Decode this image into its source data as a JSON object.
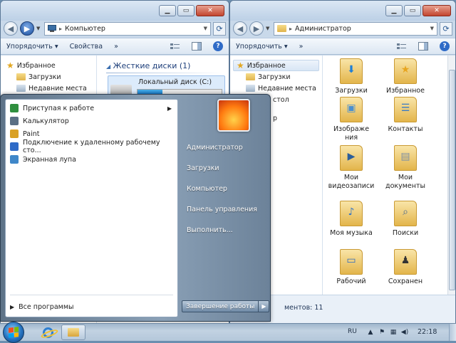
{
  "window1": {
    "address": "Компьютер",
    "toolbar": {
      "organize": "Упорядочить",
      "properties": "Свойства",
      "more": "»"
    },
    "nav": {
      "favorites": "Избранное",
      "downloads": "Загрузки",
      "recent": "Недавние места"
    },
    "group_title": "Жесткие диски (1)",
    "disk": {
      "name": "Локальный диск (C:)",
      "used_fraction": 0.3
    }
  },
  "window2": {
    "address": "Администратор",
    "toolbar": {
      "organize": "Упорядочить",
      "more": "»"
    },
    "nav": {
      "favorites": "Избранное",
      "downloads": "Загрузки",
      "recent": "Недавние места",
      "desktop_partial": "стол",
      "partial2": "р"
    },
    "items": [
      {
        "label": "Загрузки",
        "icon": "download-arrow"
      },
      {
        "label": "Избранное",
        "icon": "star"
      },
      {
        "label": "Изображе ния",
        "icon": "pictures"
      },
      {
        "label": "Контакты",
        "icon": "contacts"
      },
      {
        "label": "Мои видеозаписи",
        "icon": "video"
      },
      {
        "label": "Мои документы",
        "icon": "documents"
      },
      {
        "label": "Моя музыка",
        "icon": "music-note"
      },
      {
        "label": "Поиски",
        "icon": "magnifier"
      },
      {
        "label": "Рабочий",
        "icon": "desktop"
      },
      {
        "label": "Сохранен",
        "icon": "chess-piece"
      }
    ],
    "status": "ментов: 11"
  },
  "startmenu": {
    "programs": [
      {
        "label": "Приступая к работе",
        "has_submenu": true,
        "color": "#2f8f3e"
      },
      {
        "label": "Калькулятор",
        "has_submenu": false,
        "color": "#5b6f84"
      },
      {
        "label": "Paint",
        "has_submenu": false,
        "color": "#d9a125"
      },
      {
        "label": "Подключение к удаленному рабочему сто...",
        "has_submenu": false,
        "color": "#2f6bc7"
      },
      {
        "label": "Экранная лупа",
        "has_submenu": false,
        "color": "#3f87c9"
      }
    ],
    "all_programs": "Все программы",
    "right_links": [
      "Администратор",
      "Загрузки",
      "Компьютер",
      "Панель управления",
      "Выполнить..."
    ],
    "shutdown": "Завершение работы"
  },
  "taskbar": {
    "lang": "RU",
    "clock": "22:18"
  }
}
